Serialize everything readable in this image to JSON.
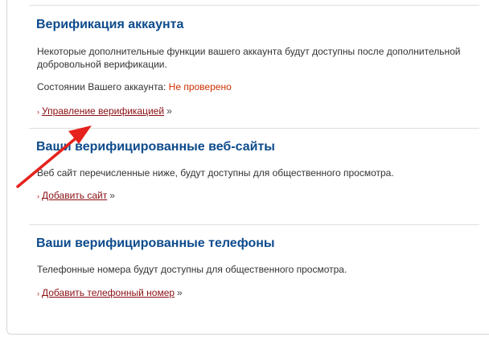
{
  "sections": [
    {
      "title": "Верификация аккаунта",
      "description": "Некоторые дополнительные функции вашего аккаунта будут доступны после дополнительной добровольной верификации.",
      "status_label": "Состоянии Вашего аккаунта:",
      "status_value": "Не проверено",
      "action_label": "Управление верификацией",
      "action_suffix": "»"
    },
    {
      "title": "Ваши верифицированные веб-сайты",
      "description": "Веб сайт перечисленные ниже, будут доступны для общественного просмотра.",
      "action_label": "Добавить сайт",
      "action_suffix": "»"
    },
    {
      "title": "Ваши верифицированные телефоны",
      "description": "Телефонные номера будут доступны для общественного просмотра.",
      "action_label": "Добавить телефонный номер",
      "action_suffix": "»"
    }
  ],
  "bullet_symbol": "›",
  "colors": {
    "heading": "#0d4b8c",
    "link": "#8b0f14",
    "status": "#d03000",
    "arrow": "#e5221d"
  }
}
